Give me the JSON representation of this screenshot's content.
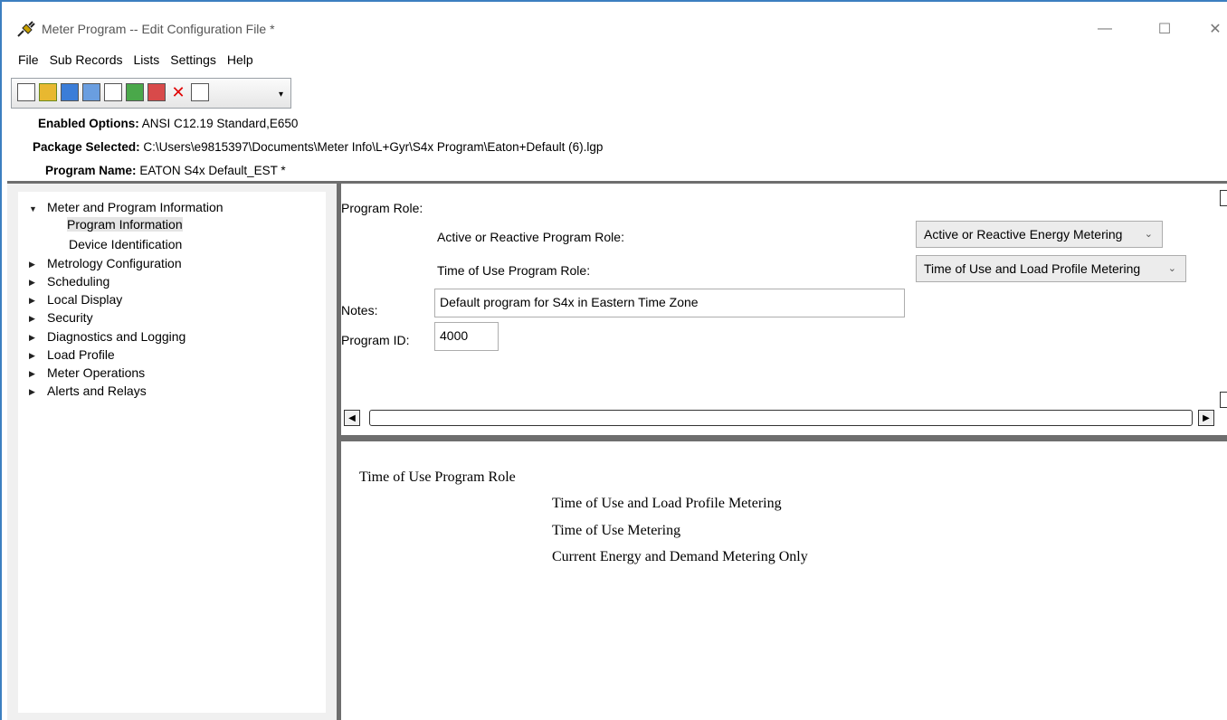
{
  "window": {
    "title": "Meter Program -- Edit Configuration File *",
    "controls": {
      "minimize": "—",
      "maximize": "☐",
      "close": "✕"
    }
  },
  "menu": [
    "File",
    "Sub Records",
    "Lists",
    "Settings",
    "Help"
  ],
  "toolbar": {
    "buttons": [
      "new-file-icon",
      "open-folder-icon",
      "save-icon",
      "edit-icon",
      "properties-icon",
      "import-icon",
      "export-icon",
      "delete-icon",
      "clipboard-icon"
    ],
    "dropdown": "▾"
  },
  "info": {
    "enabled_options_label": "Enabled Options:",
    "enabled_options_value": "ANSI C12.19 Standard,E650",
    "package_label": "Package Selected:",
    "package_value": "C:\\Users\\e9815397\\Documents\\Meter Info\\L+Gyr\\S4x Program\\Eaton+Default (6).lgp",
    "program_name_label": "Program Name:",
    "program_name_value": "EATON S4x Default_EST *"
  },
  "tree": {
    "items": [
      {
        "label": "Meter and Program Information",
        "expanded": true
      },
      {
        "label": "Program Information",
        "selected": true
      },
      {
        "label": "Device Identification"
      },
      {
        "label": "Metrology Configuration"
      },
      {
        "label": "Scheduling"
      },
      {
        "label": "Local Display"
      },
      {
        "label": "Security"
      },
      {
        "label": "Diagnostics and Logging"
      },
      {
        "label": "Load Profile"
      },
      {
        "label": "Meter Operations"
      },
      {
        "label": "Alerts and Relays"
      }
    ]
  },
  "form": {
    "program_role_label": "Program Role:",
    "active_reactive_label": "Active or Reactive Program Role:",
    "active_reactive_value": "Active or Reactive Energy Metering",
    "tou_label": "Time of Use Program Role:",
    "tou_value": "Time of Use and Load Profile Metering",
    "notes_label": "Notes:",
    "notes_value": "Default program for S4x in Eastern Time Zone",
    "program_id_label": "Program ID:",
    "program_id_value": "4000"
  },
  "description": {
    "heading": "Time of Use Program Role",
    "options": [
      "Time of Use and Load Profile Metering",
      "Time of Use Metering",
      "Current Energy and Demand Metering Only"
    ]
  },
  "colors": {
    "window_border": "#3c7fc0",
    "pane_border": "#6e6e6e",
    "selection": "#e4e4e4"
  }
}
